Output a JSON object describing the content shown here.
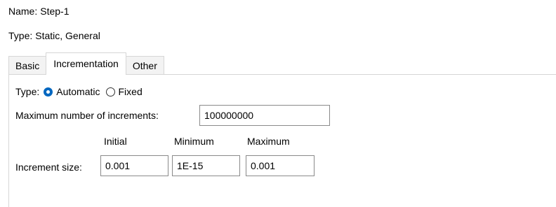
{
  "step": {
    "name_label": "Name:",
    "name_value": "Step-1",
    "type_label": "Type:",
    "type_value": "Static, General"
  },
  "tabs": [
    {
      "label": "Basic",
      "active": false
    },
    {
      "label": "Incrementation",
      "active": true
    },
    {
      "label": "Other",
      "active": false
    }
  ],
  "incrementation": {
    "type_label": "Type:",
    "type_options": [
      {
        "label": "Automatic",
        "checked": true
      },
      {
        "label": "Fixed",
        "checked": false
      }
    ],
    "max_increments_label": "Maximum number of increments:",
    "max_increments_value": "100000000",
    "columns": {
      "initial": "Initial",
      "minimum": "Minimum",
      "maximum": "Maximum"
    },
    "increment_size_label": "Increment size:",
    "increment_size": {
      "initial": "0.001",
      "minimum": "1E-15",
      "maximum": "0.001"
    }
  },
  "colors": {
    "accent": "#0067c0",
    "border": "#d6d6d6",
    "tab_inactive_bg": "#f3f3f3"
  }
}
